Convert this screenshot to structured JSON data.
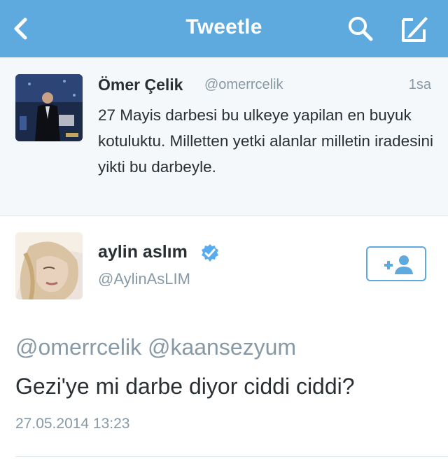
{
  "nav": {
    "title": "Tweetle",
    "back_icon": "chevron-left-icon",
    "search_icon": "search-icon",
    "compose_icon": "compose-icon"
  },
  "parent_tweet": {
    "name": "Ömer Çelik",
    "handle": "@omerrcelik",
    "time": "1sa",
    "text": "27 Mayis darbesi bu ulkeye yapilan en buyuk kotuluktu. Milletten yetki alanlar milletin iradesini yikti bu darbeyle."
  },
  "main_tweet": {
    "name": "aylin aslım",
    "handle": "@AylinAsLIM",
    "verified_icon": "verified-badge-icon",
    "follow_icon": "add-user-icon",
    "mentions": "@omerrcelik @kaansezyum",
    "text": "Gezi'ye mi darbe diyor ciddi ciddi?",
    "timestamp": "27.05.2014 13:23"
  },
  "colors": {
    "nav_bg": "#5ea9dd",
    "parent_bg": "#f5f8fa",
    "text": "#292f33",
    "muted": "#8899a6",
    "verified": "#55acee"
  }
}
